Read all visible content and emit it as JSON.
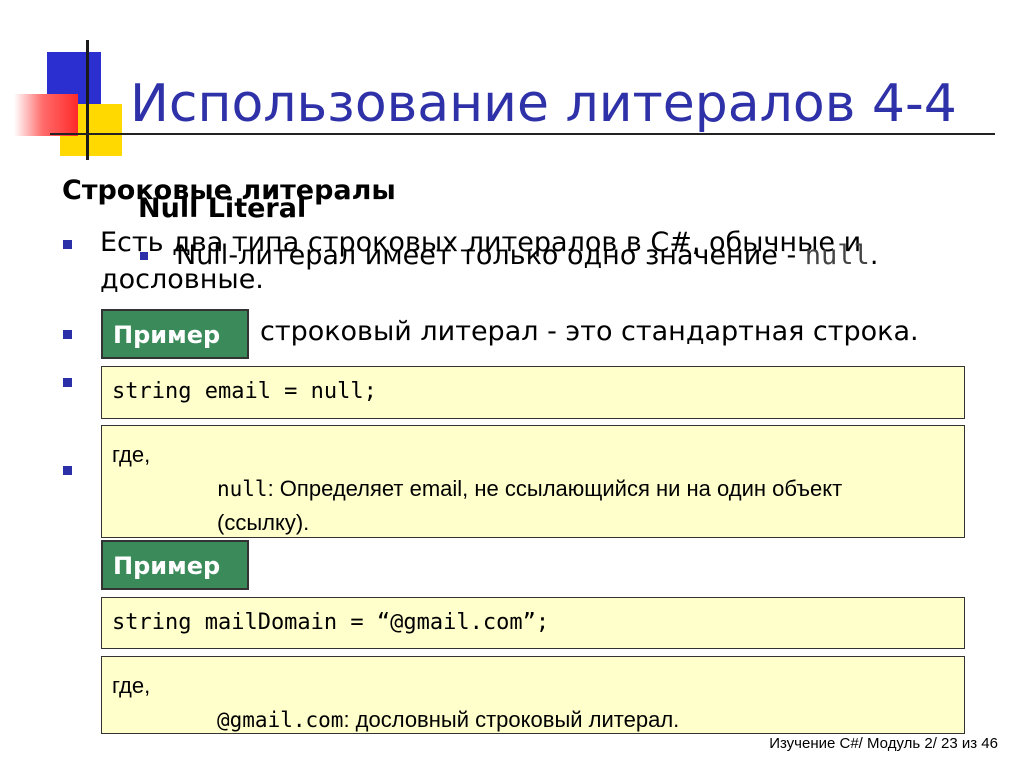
{
  "title": "Использование литералов 4-4",
  "string_literals": {
    "heading": "Строковые литералы",
    "bullet1_line1": "Есть два типа строковых литералов в C#, обычные и",
    "bullet1_line2": "дословные.",
    "bullet2": "строковый литерал - это стандартная строка."
  },
  "null_literal": {
    "heading": "Null Literal",
    "bullet_text": "Null-литерал имеет только одно значение - ",
    "bullet_code": "null",
    "bullet_end": "."
  },
  "example1": {
    "label": "Пример",
    "code": "string email = null;",
    "where": "где,",
    "term": "null",
    "desc_line1": ": Определяет email, не ссылающийся ни на один объект",
    "desc_line2": "(ссылку)."
  },
  "example2": {
    "label": "Пример",
    "code": "string mailDomain = “@gmail.com”;",
    "where": "где,",
    "term": "@gmail.com",
    "desc": ": дословный строковый литерал."
  },
  "footer": "Изучение C#/ Модуль 2/ 23 из 46",
  "colors": {
    "title": "#2f31a8",
    "example_label_bg": "#3a8a5a",
    "box_bg": "#ffffcc",
    "bullet": "#2b2fa8"
  }
}
